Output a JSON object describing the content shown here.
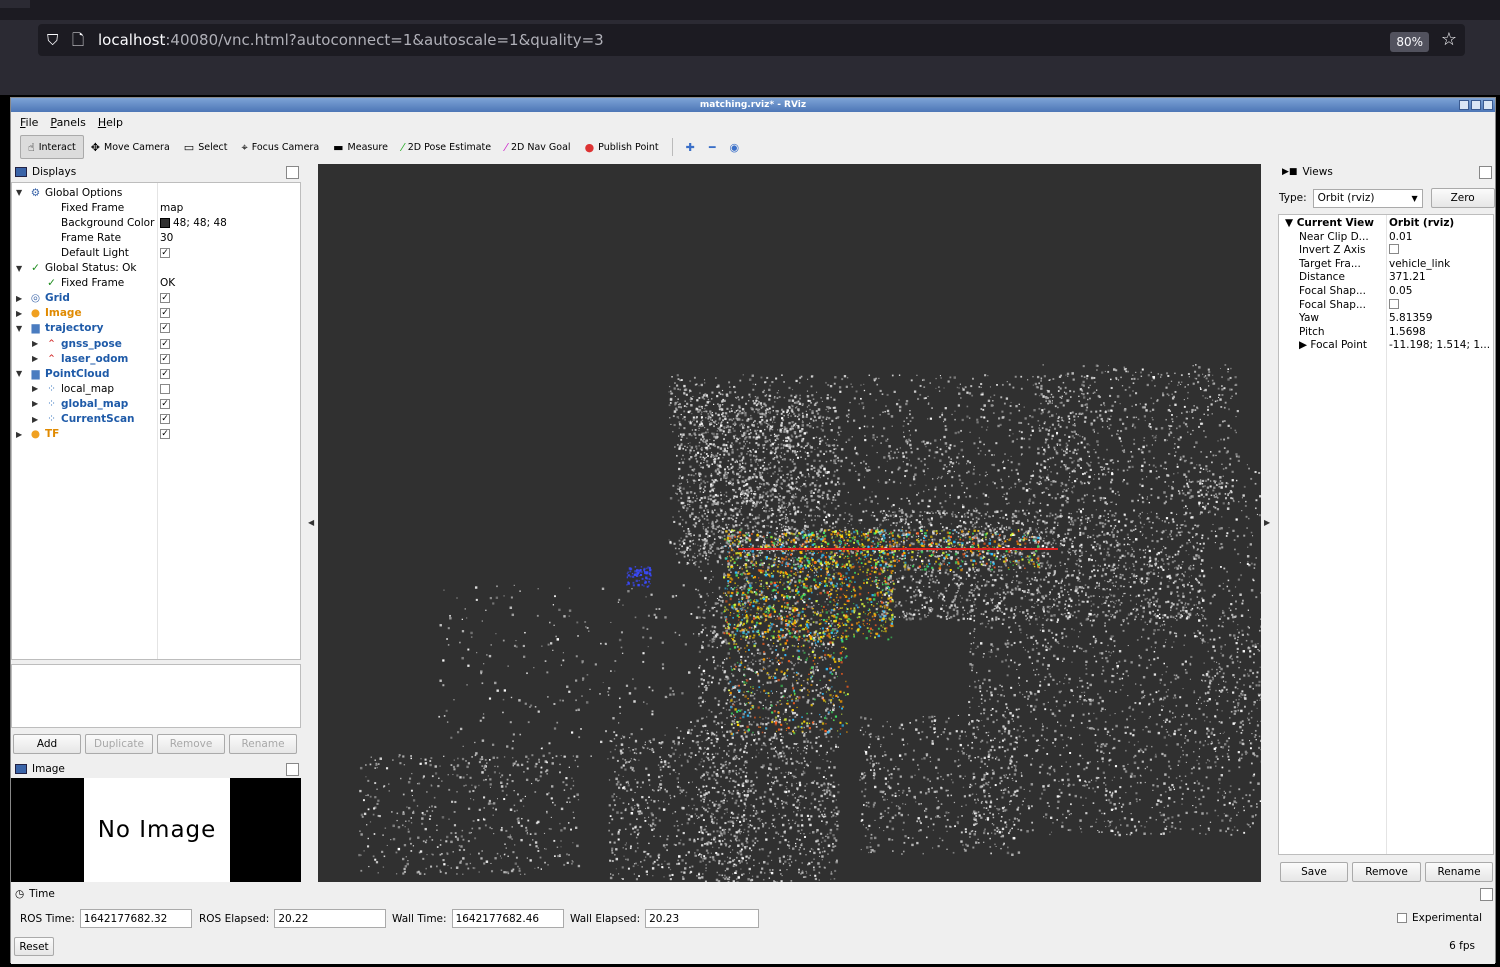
{
  "browser": {
    "url_host": "localhost",
    "url_rest": ":40080/vnc.html?autoconnect=1&autoscale=1&quality=3",
    "zoom": "80%"
  },
  "window": {
    "title": "matching.rviz* - RViz"
  },
  "menu": [
    "File",
    "Panels",
    "Help"
  ],
  "toolbar": [
    {
      "label": "Interact",
      "icon": "hand-icon",
      "glyph": "☝",
      "active": true
    },
    {
      "label": "Move Camera",
      "icon": "move-camera-icon",
      "glyph": "✥"
    },
    {
      "label": "Select",
      "icon": "select-icon",
      "glyph": "▭"
    },
    {
      "label": "Focus Camera",
      "icon": "focus-camera-icon",
      "glyph": "⌖"
    },
    {
      "label": "Measure",
      "icon": "ruler-icon",
      "glyph": "▬"
    },
    {
      "label": "2D Pose Estimate",
      "icon": "pose-estimate-icon",
      "glyph": "⁄",
      "color": "#22aa22"
    },
    {
      "label": "2D Nav Goal",
      "icon": "nav-goal-icon",
      "glyph": "⁄",
      "color": "#cc22cc"
    },
    {
      "label": "Publish Point",
      "icon": "map-pin-icon",
      "glyph": "●",
      "color": "#d33"
    }
  ],
  "toolbar_extra": [
    {
      "icon": "plus-icon",
      "glyph": "✚"
    },
    {
      "icon": "minus-icon",
      "glyph": "━"
    },
    {
      "icon": "eye-icon",
      "glyph": "◉"
    }
  ],
  "displays": {
    "title": "Displays",
    "rows": [
      {
        "indent": 0,
        "arrow": "▼",
        "icon": "⚙",
        "icon_name": "gear-icon",
        "label": "Global Options",
        "style": "",
        "value": ""
      },
      {
        "indent": 1,
        "arrow": "",
        "icon": "",
        "label": "Fixed Frame",
        "style": "",
        "value": "map"
      },
      {
        "indent": 1,
        "arrow": "",
        "icon": "",
        "label": "Background Color",
        "style": "",
        "value": "48; 48; 48",
        "swatch": true
      },
      {
        "indent": 1,
        "arrow": "",
        "icon": "",
        "label": "Frame Rate",
        "style": "",
        "value": "30"
      },
      {
        "indent": 1,
        "arrow": "",
        "icon": "",
        "label": "Default Light",
        "style": "",
        "check": true,
        "checked": true
      },
      {
        "indent": 0,
        "arrow": "▼",
        "icon": "✓",
        "icon_name": "check-icon",
        "icon_color": "#1a8a1a",
        "label": "Global Status: Ok",
        "style": "",
        "value": ""
      },
      {
        "indent": 1,
        "arrow": "",
        "icon": "✓",
        "icon_name": "check-icon",
        "icon_color": "#1a8a1a",
        "label": "Fixed Frame",
        "style": "",
        "value": "OK"
      },
      {
        "indent": 0,
        "arrow": "▶",
        "icon": "◎",
        "icon_name": "grid-icon",
        "label": "Grid",
        "style": "blue",
        "check": true,
        "checked": true
      },
      {
        "indent": 0,
        "arrow": "▶",
        "icon": "●",
        "icon_name": "warning-icon",
        "icon_color": "#f0a020",
        "label": "Image",
        "style": "orange",
        "check": true,
        "checked": true
      },
      {
        "indent": 0,
        "arrow": "▼",
        "icon": "▆",
        "icon_name": "folder-icon",
        "icon_color": "#4a7cc0",
        "label": "trajectory",
        "style": "blue",
        "check": true,
        "checked": true
      },
      {
        "indent": 1,
        "arrow": "▶",
        "icon": "⌃",
        "icon_name": "path-icon",
        "icon_color": "#d02020",
        "label": "gnss_pose",
        "style": "blue",
        "check": true,
        "checked": true
      },
      {
        "indent": 1,
        "arrow": "▶",
        "icon": "⌃",
        "icon_name": "path-icon",
        "icon_color": "#d02020",
        "label": "laser_odom",
        "style": "blue",
        "check": true,
        "checked": true
      },
      {
        "indent": 0,
        "arrow": "▼",
        "icon": "▆",
        "icon_name": "folder-icon",
        "icon_color": "#4a7cc0",
        "label": "PointCloud",
        "style": "blue",
        "check": true,
        "checked": true
      },
      {
        "indent": 1,
        "arrow": "▶",
        "icon": "⁘",
        "icon_name": "pointcloud-icon",
        "icon_color": "#3a78c0",
        "label": "local_map",
        "style": "",
        "check": true,
        "checked": false
      },
      {
        "indent": 1,
        "arrow": "▶",
        "icon": "⁘",
        "icon_name": "pointcloud-icon",
        "icon_color": "#3a78c0",
        "label": "global_map",
        "style": "blue",
        "check": true,
        "checked": true
      },
      {
        "indent": 1,
        "arrow": "▶",
        "icon": "⁘",
        "icon_name": "pointcloud-icon",
        "icon_color": "#3a78c0",
        "label": "CurrentScan",
        "style": "blue",
        "check": true,
        "checked": true
      },
      {
        "indent": 0,
        "arrow": "▶",
        "icon": "●",
        "icon_name": "warning-icon",
        "icon_color": "#f0a020",
        "label": "TF",
        "style": "orange",
        "check": true,
        "checked": true
      }
    ],
    "buttons": {
      "add": "Add",
      "duplicate": "Duplicate",
      "remove": "Remove",
      "rename": "Rename"
    }
  },
  "image_panel": {
    "title": "Image",
    "placeholder": "No Image"
  },
  "views": {
    "title": "Views",
    "type_label": "Type:",
    "type_value": "Orbit (rviz)",
    "zero": "Zero",
    "rows": [
      {
        "label": "Current View",
        "value": "Orbit (rviz)",
        "bold": true,
        "arrow": "▼",
        "indent": 0
      },
      {
        "label": "Near Clip D...",
        "value": "0.01",
        "indent": 1
      },
      {
        "label": "Invert Z Axis",
        "value": "",
        "check": true,
        "indent": 1
      },
      {
        "label": "Target Fra...",
        "value": "vehicle_link",
        "indent": 1
      },
      {
        "label": "Distance",
        "value": "371.21",
        "indent": 1
      },
      {
        "label": "Focal Shap...",
        "value": "0.05",
        "indent": 1
      },
      {
        "label": "Focal Shap...",
        "value": "",
        "check": true,
        "indent": 1
      },
      {
        "label": "Yaw",
        "value": "5.81359",
        "indent": 1
      },
      {
        "label": "Pitch",
        "value": "1.5698",
        "indent": 1
      },
      {
        "label": "Focal Point",
        "value": "-11.198; 1.514; 1...",
        "arrow": "▶",
        "indent": 1
      }
    ],
    "buttons": {
      "save": "Save",
      "remove": "Remove",
      "rename": "Rename"
    }
  },
  "time": {
    "title": "Time",
    "ros_time_label": "ROS Time:",
    "ros_time": "1642177682.32",
    "ros_elapsed_label": "ROS Elapsed:",
    "ros_elapsed": "20.22",
    "wall_time_label": "Wall Time:",
    "wall_time": "1642177682.46",
    "wall_elapsed_label": "Wall Elapsed:",
    "wall_elapsed": "20.23",
    "experimental": "Experimental",
    "reset": "Reset",
    "fps": "6 fps"
  }
}
